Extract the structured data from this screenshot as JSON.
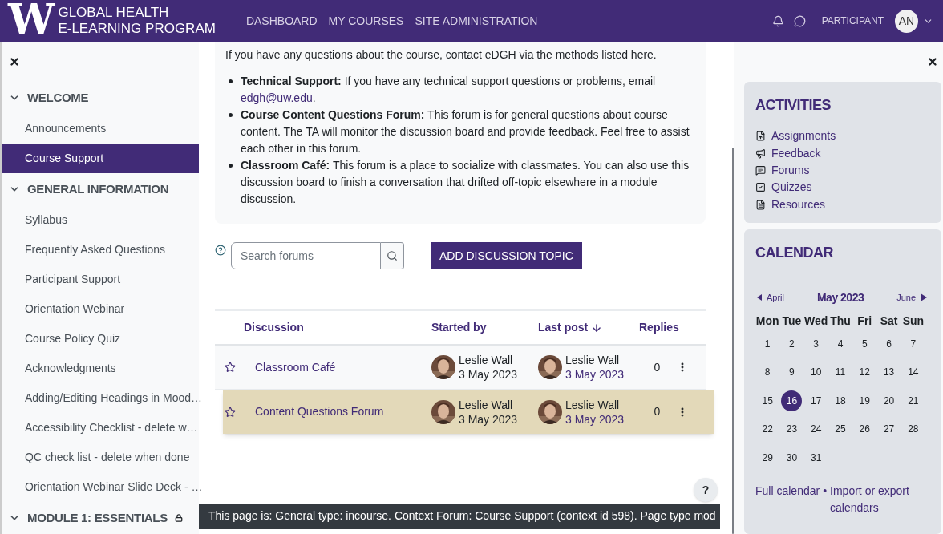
{
  "header": {
    "logo_letter": "W",
    "brand_lines": [
      "GLOBAL HEALTH",
      "E-LEARNING PROGRAM"
    ],
    "nav": [
      "DASHBOARD",
      "MY COURSES",
      "SITE ADMINISTRATION"
    ],
    "role": "PARTICIPANT",
    "avatar_initials": "AN"
  },
  "sidebar": {
    "sections": [
      {
        "title": "WELCOME",
        "expanded": true,
        "locked": false,
        "items": [
          {
            "label": "Announcements",
            "selected": false
          },
          {
            "label": "Course Support",
            "selected": true
          }
        ]
      },
      {
        "title": "GENERAL INFORMATION",
        "expanded": true,
        "locked": false,
        "items": [
          {
            "label": "Syllabus",
            "selected": false
          },
          {
            "label": "Frequently Asked Questions",
            "selected": false
          },
          {
            "label": "Participant Support",
            "selected": false
          },
          {
            "label": "Orientation Webinar",
            "selected": false
          },
          {
            "label": "Course Policy Quiz",
            "selected": false
          },
          {
            "label": "Acknowledgments",
            "selected": false
          },
          {
            "label": "Adding/Editing Headings in Mood…",
            "selected": false
          },
          {
            "label": "Accessibility Checklist - delete w…",
            "selected": false
          },
          {
            "label": "QC check list - delete when done",
            "selected": false
          },
          {
            "label": "Orientation Webinar Slide Deck - …",
            "selected": false
          }
        ]
      },
      {
        "title": "MODULE 1: ESSENTIALS",
        "expanded": true,
        "locked": true
      }
    ]
  },
  "intro": {
    "lead": "If you have any questions about the course, contact eDGH via the methods listed here.",
    "bullets": [
      {
        "label": "Technical Support:",
        "text": " If you have any technical support questions or problems, email ",
        "link": "edgh@uw.edu",
        "after": "."
      },
      {
        "label": "Course Content Questions Forum:",
        "text": " This forum is for general questions about course content. The TA will monitor the discussion board and provide feedback. Feel free to assist each other in this forum."
      },
      {
        "label": "Classroom Café:",
        "text": " This forum is a place to socialize with classmates. You can also use this discussion board to finish a conversation that drifted off-topic elsewhere in a module discussion."
      }
    ]
  },
  "search": {
    "placeholder": "Search forums"
  },
  "add_button": "ADD DISCUSSION TOPIC",
  "table": {
    "columns": [
      {
        "label": "Discussion",
        "sorted": false
      },
      {
        "label": "Started by",
        "sorted": false
      },
      {
        "label": "Last post",
        "sorted": true
      },
      {
        "label": "Replies",
        "sorted": false
      }
    ],
    "rows": [
      {
        "title": "Classroom Café",
        "starred": false,
        "highlighted": false,
        "started_by": {
          "name": "Leslie Wall",
          "date": "3 May 2023"
        },
        "last_post": {
          "name": "Leslie Wall",
          "date": "3 May 2023"
        },
        "replies": "0"
      },
      {
        "title": "Content Questions Forum",
        "starred": false,
        "highlighted": true,
        "started_by": {
          "name": "Leslie Wall",
          "date": "3 May 2023"
        },
        "last_post": {
          "name": "Leslie Wall",
          "date": "3 May 2023"
        },
        "replies": "0"
      }
    ]
  },
  "footer": {
    "text": "This page is: General type: incourse. Context Forum: Course Support (context id 598). Page type mod",
    "help": "?"
  },
  "activities": {
    "title": "ACTIVITIES",
    "items": [
      "Assignments",
      "Feedback",
      "Forums",
      "Quizzes",
      "Resources"
    ]
  },
  "calendar": {
    "title": "CALENDAR",
    "prev": "April",
    "month": "May 2023",
    "next": "June",
    "weekdays": [
      "Mon",
      "Tue",
      "Wed",
      "Thu",
      "Fri",
      "Sat",
      "Sun"
    ],
    "weeks": [
      [
        {
          "day": "1",
          "selected": false
        },
        {
          "day": "2",
          "selected": false
        },
        {
          "day": "3",
          "selected": false
        },
        {
          "day": "4",
          "selected": false
        },
        {
          "day": "5",
          "selected": false
        },
        {
          "day": "6",
          "selected": false
        },
        {
          "day": "7",
          "selected": false
        }
      ],
      [
        {
          "day": "8",
          "selected": false
        },
        {
          "day": "9",
          "selected": false
        },
        {
          "day": "10",
          "selected": false
        },
        {
          "day": "11",
          "selected": false
        },
        {
          "day": "12",
          "selected": false
        },
        {
          "day": "13",
          "selected": false
        },
        {
          "day": "14",
          "selected": false
        }
      ],
      [
        {
          "day": "15",
          "selected": false
        },
        {
          "day": "16",
          "selected": true
        },
        {
          "day": "17",
          "selected": false
        },
        {
          "day": "18",
          "selected": false
        },
        {
          "day": "19",
          "selected": false
        },
        {
          "day": "20",
          "selected": false
        },
        {
          "day": "21",
          "selected": false
        }
      ],
      [
        {
          "day": "22",
          "selected": false
        },
        {
          "day": "23",
          "selected": false
        },
        {
          "day": "24",
          "selected": false
        },
        {
          "day": "25",
          "selected": false
        },
        {
          "day": "26",
          "selected": false
        },
        {
          "day": "27",
          "selected": false
        },
        {
          "day": "28",
          "selected": false
        }
      ],
      [
        {
          "day": "29",
          "selected": false
        },
        {
          "day": "30",
          "selected": false
        },
        {
          "day": "31",
          "selected": false
        }
      ]
    ],
    "links": [
      "Full calendar",
      "Import or export calendars"
    ],
    "separator": "•"
  }
}
